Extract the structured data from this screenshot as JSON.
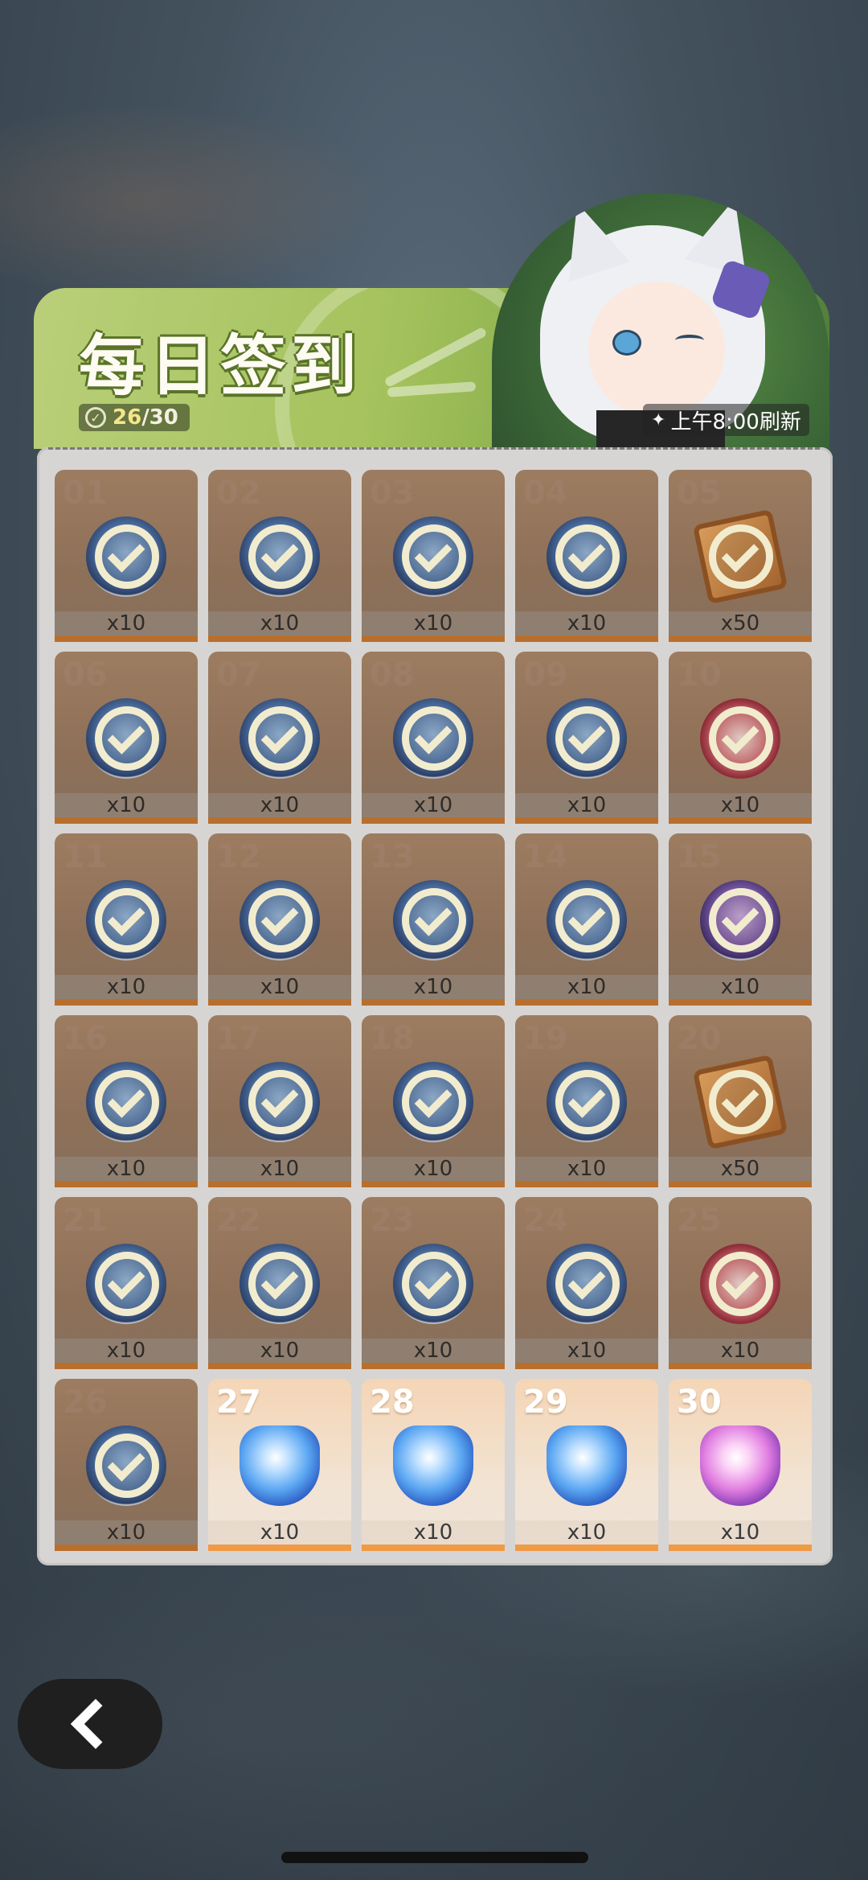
{
  "header": {
    "title": "每日签到",
    "progress_current": "26",
    "progress_total": "/30",
    "refresh_text": "上午8:00刷新"
  },
  "days": [
    {
      "num": "01",
      "qty": "x10",
      "item": "token",
      "claimed": true
    },
    {
      "num": "02",
      "qty": "x10",
      "item": "token",
      "claimed": true
    },
    {
      "num": "03",
      "qty": "x10",
      "item": "token",
      "claimed": true
    },
    {
      "num": "04",
      "qty": "x10",
      "item": "token",
      "claimed": true
    },
    {
      "num": "05",
      "qty": "x50",
      "item": "ticket",
      "claimed": true
    },
    {
      "num": "06",
      "qty": "x10",
      "item": "token",
      "claimed": true
    },
    {
      "num": "07",
      "qty": "x10",
      "item": "token",
      "claimed": true
    },
    {
      "num": "08",
      "qty": "x10",
      "item": "token",
      "claimed": true
    },
    {
      "num": "09",
      "qty": "x10",
      "item": "token",
      "claimed": true
    },
    {
      "num": "10",
      "qty": "x10",
      "item": "amulet",
      "claimed": true
    },
    {
      "num": "11",
      "qty": "x10",
      "item": "token",
      "claimed": true
    },
    {
      "num": "12",
      "qty": "x10",
      "item": "token",
      "claimed": true
    },
    {
      "num": "13",
      "qty": "x10",
      "item": "token",
      "claimed": true
    },
    {
      "num": "14",
      "qty": "x10",
      "item": "token",
      "claimed": true
    },
    {
      "num": "15",
      "qty": "x10",
      "item": "token-purple",
      "claimed": true
    },
    {
      "num": "16",
      "qty": "x10",
      "item": "token",
      "claimed": true
    },
    {
      "num": "17",
      "qty": "x10",
      "item": "token",
      "claimed": true
    },
    {
      "num": "18",
      "qty": "x10",
      "item": "token",
      "claimed": true
    },
    {
      "num": "19",
      "qty": "x10",
      "item": "token",
      "claimed": true
    },
    {
      "num": "20",
      "qty": "x50",
      "item": "ticket",
      "claimed": true
    },
    {
      "num": "21",
      "qty": "x10",
      "item": "token",
      "claimed": true
    },
    {
      "num": "22",
      "qty": "x10",
      "item": "token",
      "claimed": true
    },
    {
      "num": "23",
      "qty": "x10",
      "item": "token",
      "claimed": true
    },
    {
      "num": "24",
      "qty": "x10",
      "item": "token",
      "claimed": true
    },
    {
      "num": "25",
      "qty": "x10",
      "item": "amulet",
      "claimed": true
    },
    {
      "num": "26",
      "qty": "x10",
      "item": "token",
      "claimed": true
    },
    {
      "num": "27",
      "qty": "x10",
      "item": "gem-blue",
      "claimed": false
    },
    {
      "num": "28",
      "qty": "x10",
      "item": "gem-blue",
      "claimed": false
    },
    {
      "num": "29",
      "qty": "x10",
      "item": "gem-blue",
      "claimed": false
    },
    {
      "num": "30",
      "qty": "x10",
      "item": "gem-pink",
      "claimed": false
    }
  ],
  "icons": {
    "back": "chevron-left-icon",
    "progress": "check-circle-icon",
    "refresh": "sparkle-icon"
  }
}
